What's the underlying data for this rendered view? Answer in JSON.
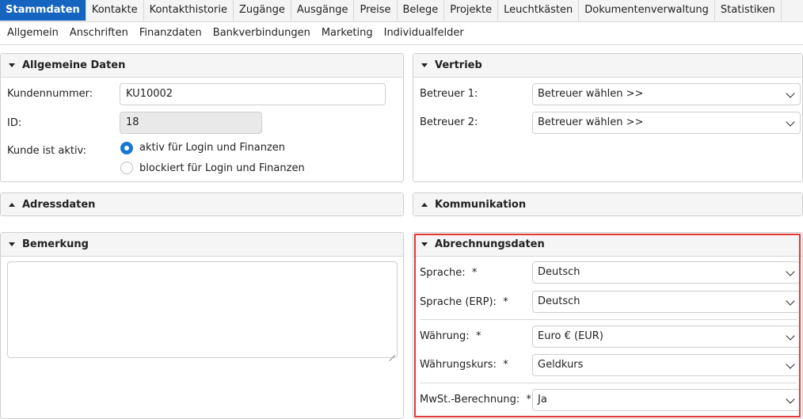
{
  "tabs": [
    "Stammdaten",
    "Kontakte",
    "Kontakthistorie",
    "Zugänge",
    "Ausgänge",
    "Preise",
    "Belege",
    "Projekte",
    "Leuchtkästen",
    "Dokumentenverwaltung",
    "Statistiken"
  ],
  "subtabs": [
    "Allgemein",
    "Anschriften",
    "Finanzdaten",
    "Bankverbindungen",
    "Marketing",
    "Individualfelder"
  ],
  "allgemein": {
    "title": "Allgemeine Daten",
    "kundennummer_label": "Kundennummer:",
    "kundennummer_value": "KU10002",
    "id_label": "ID:",
    "id_value": "18",
    "aktiv_label": "Kunde ist aktiv:",
    "radio_aktiv": "aktiv für Login und Finanzen",
    "radio_blockiert": "blockiert für Login und Finanzen"
  },
  "vertrieb": {
    "title": "Vertrieb",
    "betreuer1_label": "Betreuer 1:",
    "betreuer1_value": "Betreuer wählen >>",
    "betreuer2_label": "Betreuer 2:",
    "betreuer2_value": "Betreuer wählen >>"
  },
  "adressdaten": {
    "title": "Adressdaten"
  },
  "kommunikation": {
    "title": "Kommunikation"
  },
  "bemerkung": {
    "title": "Bemerkung",
    "value": ""
  },
  "abrechnung": {
    "title": "Abrechnungsdaten",
    "sprache_label": "Sprache:",
    "sprache_value": "Deutsch",
    "sprache_erp_label": "Sprache (ERP):",
    "sprache_erp_value": "Deutsch",
    "waehrung_label": "Währung:",
    "waehrung_value": "Euro € (EUR)",
    "waehrungskurs_label": "Währungskurs:",
    "waehrungskurs_value": "Geldkurs",
    "mwst_label": "MwSt.-Berechnung:",
    "mwst_value": "Ja",
    "required_mark": "*"
  },
  "colors": {
    "accent": "#1565c0",
    "highlight": "#e53935"
  }
}
